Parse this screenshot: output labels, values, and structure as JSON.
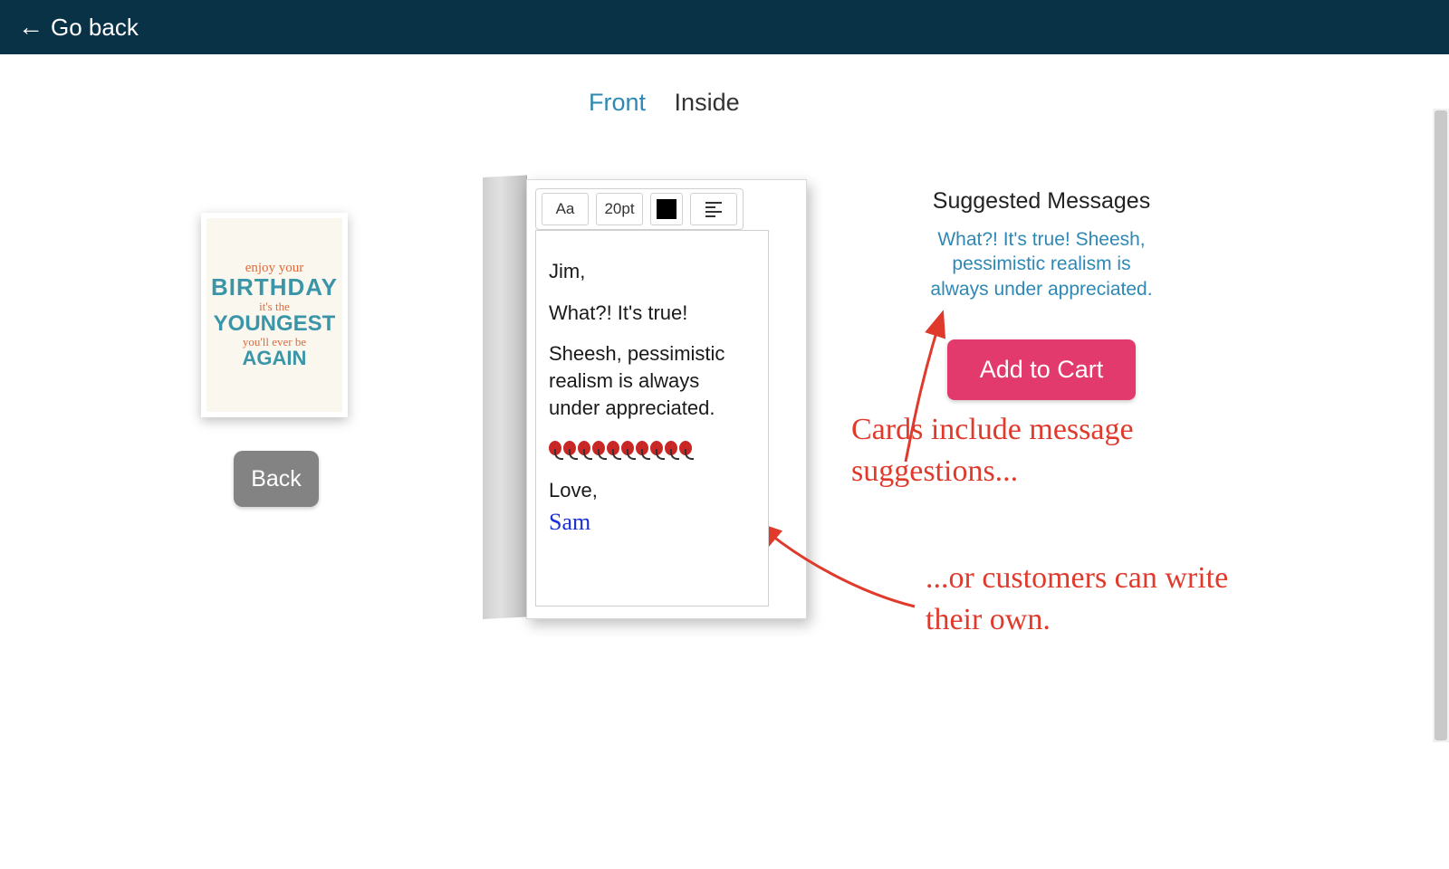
{
  "topbar": {
    "go_back": "Go back"
  },
  "tabs": {
    "front": "Front",
    "inside": "Inside",
    "active": "Front"
  },
  "preview": {
    "line1": "enjoy your",
    "line2": "BIRTHDAY",
    "line3": "it's the",
    "line4": "YOUNGEST",
    "line5": "you'll ever be",
    "line6": "AGAIN"
  },
  "back_button": "Back",
  "toolbar": {
    "font_button": "Aa",
    "size": "20pt",
    "color": "#000000",
    "align": "left"
  },
  "message": {
    "greeting": "Jim,",
    "line1": "What?! It's true!",
    "line2": "Sheesh, pessimistic realism is always under appreciated.",
    "balloon_count": 10,
    "closing": "Love,",
    "signature": "Sam"
  },
  "suggested": {
    "title": "Suggested Messages",
    "text": "What?! It's true! Sheesh, pessimistic realism is always under appreciated."
  },
  "add_to_cart": "Add to Cart",
  "annotations": {
    "a1": "Cards include message suggestions...",
    "a2": "...or customers can write their own."
  }
}
